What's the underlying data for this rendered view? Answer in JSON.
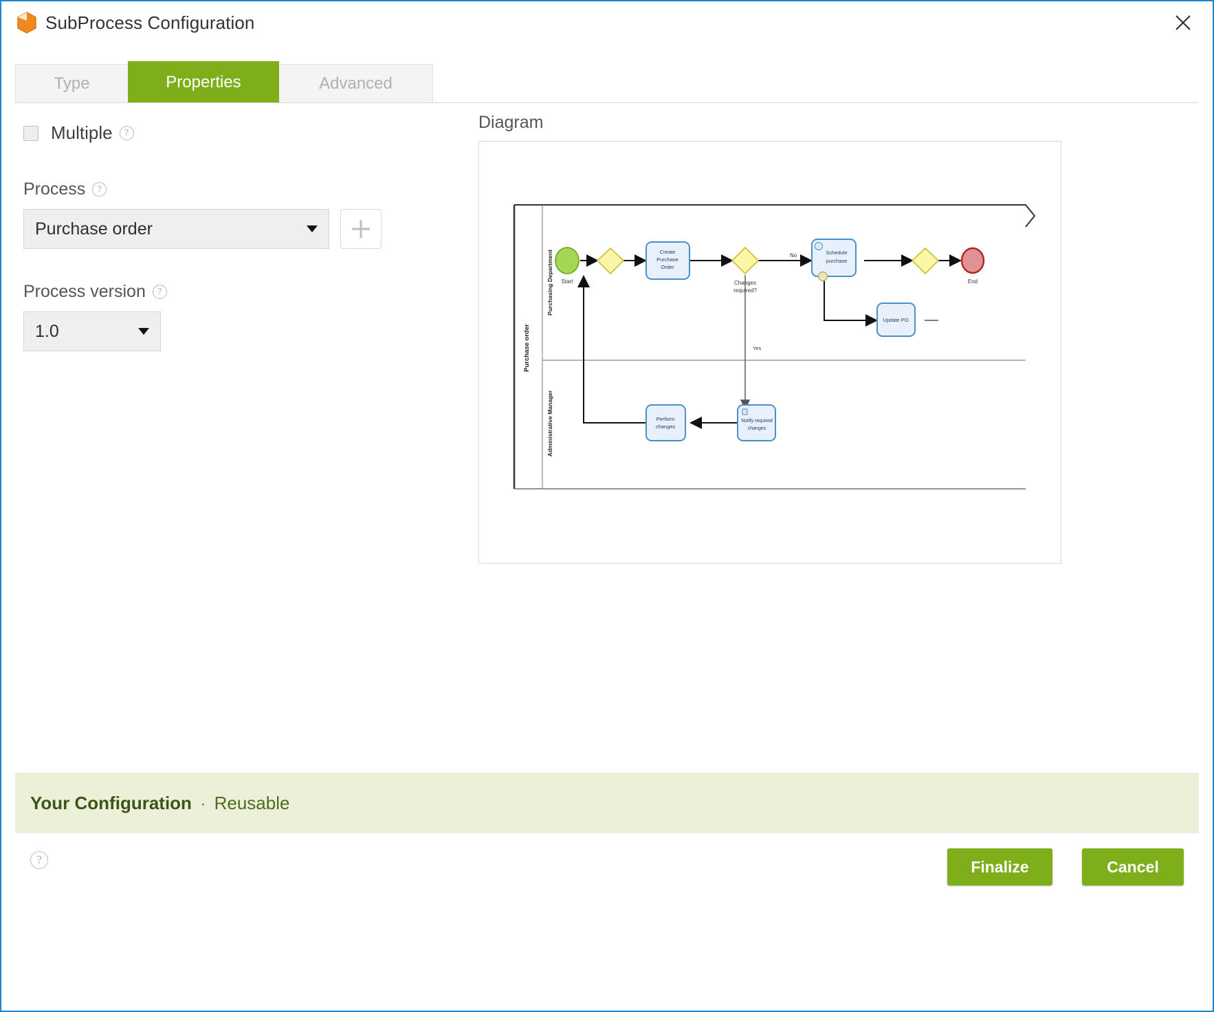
{
  "window": {
    "title": "SubProcess Configuration",
    "app_icon": "cube-icon",
    "close_icon": "close-icon",
    "accent_color": "#7fae1b",
    "border_color": "#1a86d0"
  },
  "tabs": [
    {
      "id": "type",
      "label": "Type",
      "active": false
    },
    {
      "id": "properties",
      "label": "Properties",
      "active": true
    },
    {
      "id": "advanced",
      "label": "Advanced",
      "active": false
    }
  ],
  "form": {
    "multiple": {
      "label": "Multiple",
      "checked": false,
      "help_icon": "question-mark-icon"
    },
    "process": {
      "label": "Process",
      "help_icon": "question-mark-icon",
      "value": "Purchase order",
      "caret_icon": "chevron-down-icon",
      "add_icon": "plus-icon"
    },
    "process_version": {
      "label": "Process version",
      "help_icon": "question-mark-icon",
      "value": "1.0",
      "caret_icon": "chevron-down-icon"
    }
  },
  "diagram": {
    "title": "Diagram",
    "pool": "Purchase order",
    "lanes": [
      "Purchasing Department",
      "Administrative Manager"
    ],
    "nodes": [
      {
        "id": "start",
        "type": "start-event",
        "label": "Start"
      },
      {
        "id": "gw-join",
        "type": "gateway",
        "label": ""
      },
      {
        "id": "create-po",
        "type": "task",
        "label": "Create Purchase Order"
      },
      {
        "id": "gw-changes",
        "type": "gateway",
        "label": "Changes required?"
      },
      {
        "id": "schedule",
        "type": "task",
        "label": "Schedule purchase"
      },
      {
        "id": "update",
        "type": "task",
        "label": "Update PO"
      },
      {
        "id": "gw-merge",
        "type": "gateway",
        "label": ""
      },
      {
        "id": "end",
        "type": "end-event",
        "label": "End"
      },
      {
        "id": "notify",
        "type": "task",
        "label": "Notify required changes"
      },
      {
        "id": "perform",
        "type": "task",
        "label": "Perform changes"
      }
    ],
    "edge_labels": {
      "no": "No",
      "yes": "Yes"
    },
    "colors": {
      "start": "#a5d654",
      "end": "#e09292",
      "gateway": "#fbf6a8",
      "task_fill": "#e8f0fb",
      "task_stroke": "#4a90c4"
    }
  },
  "banner": {
    "strong": "Your Configuration",
    "separator": "·",
    "normal": "Reusable"
  },
  "footer": {
    "help_icon": "question-mark-icon",
    "finalize_label": "Finalize",
    "cancel_label": "Cancel"
  }
}
